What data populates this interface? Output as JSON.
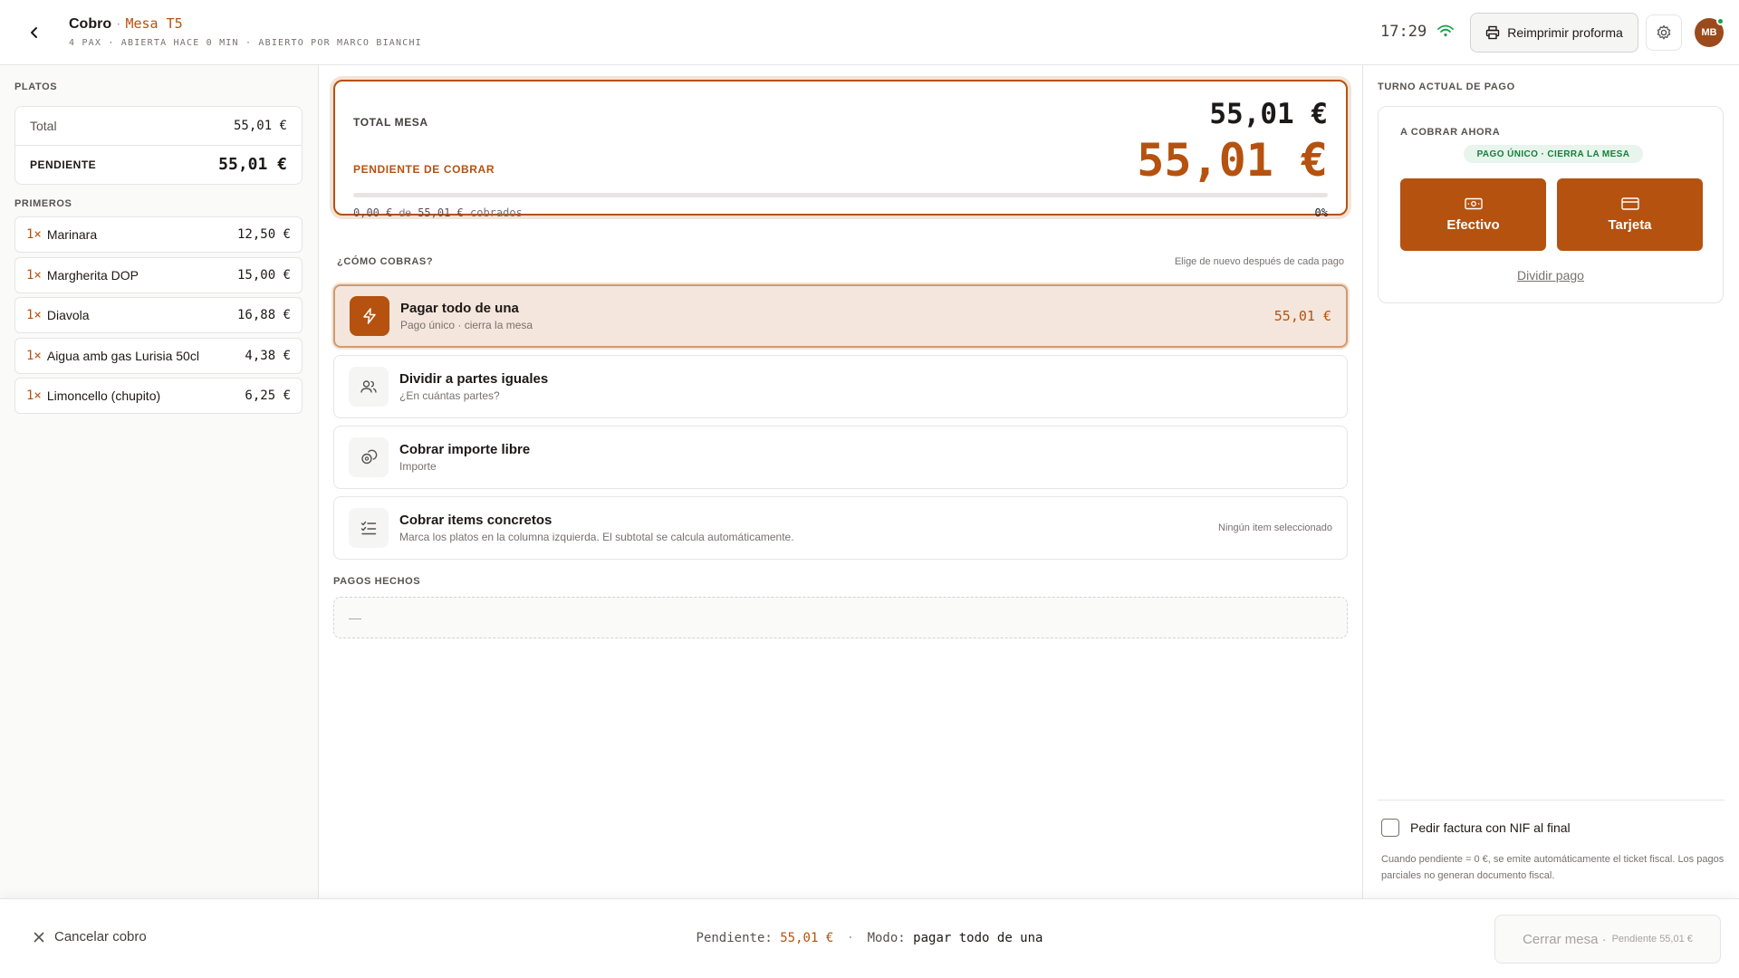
{
  "header": {
    "title": "Cobro",
    "separator": "·",
    "table": "Mesa T5",
    "subtitle": "4 PAX · ABIERTA HACE 0 MIN · ABIERTO POR MARCO BIANCHI",
    "clock": "17:29",
    "reprint_label": "Reimprimir proforma",
    "avatar_initials": "MB"
  },
  "left": {
    "platos_label": "PLATOS",
    "total_label": "Total",
    "total_value": "55,01 €",
    "pending_label": "PENDIENTE",
    "pending_value": "55,01 €",
    "primeros_label": "PRIMEROS",
    "items": [
      {
        "qty": "1×",
        "name": "Marinara",
        "price": "12,50 €"
      },
      {
        "qty": "1×",
        "name": "Margherita DOP",
        "price": "15,00 €"
      },
      {
        "qty": "1×",
        "name": "Diavola",
        "price": "16,88 €"
      },
      {
        "qty": "1×",
        "name": "Aigua amb gas Lurisia 50cl",
        "price": "4,38 €"
      },
      {
        "qty": "1×",
        "name": "Limoncello (chupito)",
        "price": "6,25 €"
      }
    ]
  },
  "center": {
    "total_mesa_label": "TOTAL MESA",
    "total_mesa_value": "55,01 €",
    "pendiente_label": "PENDIENTE DE COBRAR",
    "pendiente_value": "55,01 €",
    "progress_collected": "0,00 €",
    "progress_of": "de",
    "progress_total": "55,01 €",
    "progress_suffix": "cobrados",
    "progress_percent_text": "0%",
    "progress_fraction": 0,
    "how_label": "¿CÓMO COBRAS?",
    "how_hint": "Elige de nuevo después de cada pago",
    "options": [
      {
        "title": "Pagar todo de una",
        "sub": "Pago único · cierra la mesa",
        "right": "55,01 €",
        "icon": "lightning-icon"
      },
      {
        "title": "Dividir a partes iguales",
        "sub": "¿En cuántas partes?",
        "right": "",
        "icon": "users-icon"
      },
      {
        "title": "Cobrar importe libre",
        "sub": "Importe",
        "right": "",
        "icon": "coins-icon"
      },
      {
        "title": "Cobrar items concretos",
        "sub": "Marca los platos en la columna izquierda. El subtotal se calcula automáticamente.",
        "right": "Ningún item seleccionado",
        "icon": "checklist-icon"
      }
    ],
    "pagos_label": "PAGOS HECHOS",
    "pagos_empty": "—"
  },
  "right": {
    "turn_label": "TURNO ACTUAL DE PAGO",
    "charge_now_label": "A COBRAR AHORA",
    "badge": "PAGO ÚNICO · CIERRA LA MESA",
    "cash_label": "Efectivo",
    "card_label": "Tarjeta",
    "split_label": "Dividir pago",
    "nif_label": "Pedir factura con NIF al final",
    "nif_note": "Cuando pendiente = 0 €, se emite automáticamente el ticket fiscal. Los pagos parciales no generan documento fiscal."
  },
  "footer": {
    "cancel_label": "Cancelar cobro",
    "status_pending_label": "Pendiente:",
    "status_pending_value": "55,01 €",
    "status_sep": "·",
    "status_mode_label": "Modo:",
    "status_mode_value": "pagar todo de una",
    "close_label": "Cerrar mesa ·",
    "close_sub": "Pendiente 55,01 €"
  },
  "colors": {
    "accent": "#b5520f",
    "accent_soft": "#f4e6dc",
    "success": "#15803d",
    "online": "#16a34a"
  }
}
